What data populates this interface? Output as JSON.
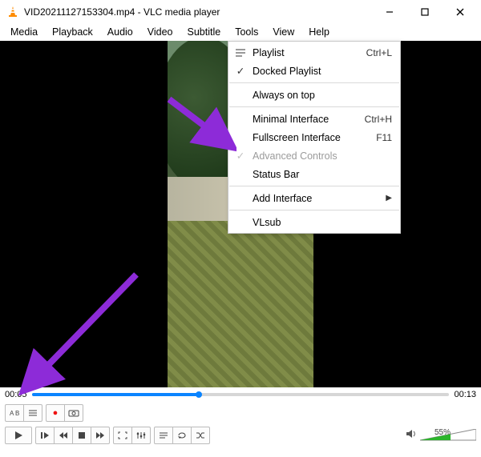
{
  "title": "VID20211127153304.mp4 - VLC media player",
  "menubar": [
    "Media",
    "Playback",
    "Audio",
    "Video",
    "Subtitle",
    "Tools",
    "View",
    "Help"
  ],
  "viewmenu": {
    "playlist": {
      "label": "Playlist",
      "shortcut": "Ctrl+L"
    },
    "docked": {
      "label": "Docked Playlist"
    },
    "always": {
      "label": "Always on top"
    },
    "minimal": {
      "label": "Minimal Interface",
      "shortcut": "Ctrl+H"
    },
    "fullscreen": {
      "label": "Fullscreen Interface",
      "shortcut": "F11"
    },
    "advanced": {
      "label": "Advanced Controls"
    },
    "status": {
      "label": "Status Bar"
    },
    "addif": {
      "label": "Add Interface"
    },
    "vlsub": {
      "label": "VLsub"
    }
  },
  "time": {
    "current": "00:05",
    "total": "00:13",
    "progress_pct": 40
  },
  "volume": {
    "pct": "55%",
    "level": 55
  }
}
